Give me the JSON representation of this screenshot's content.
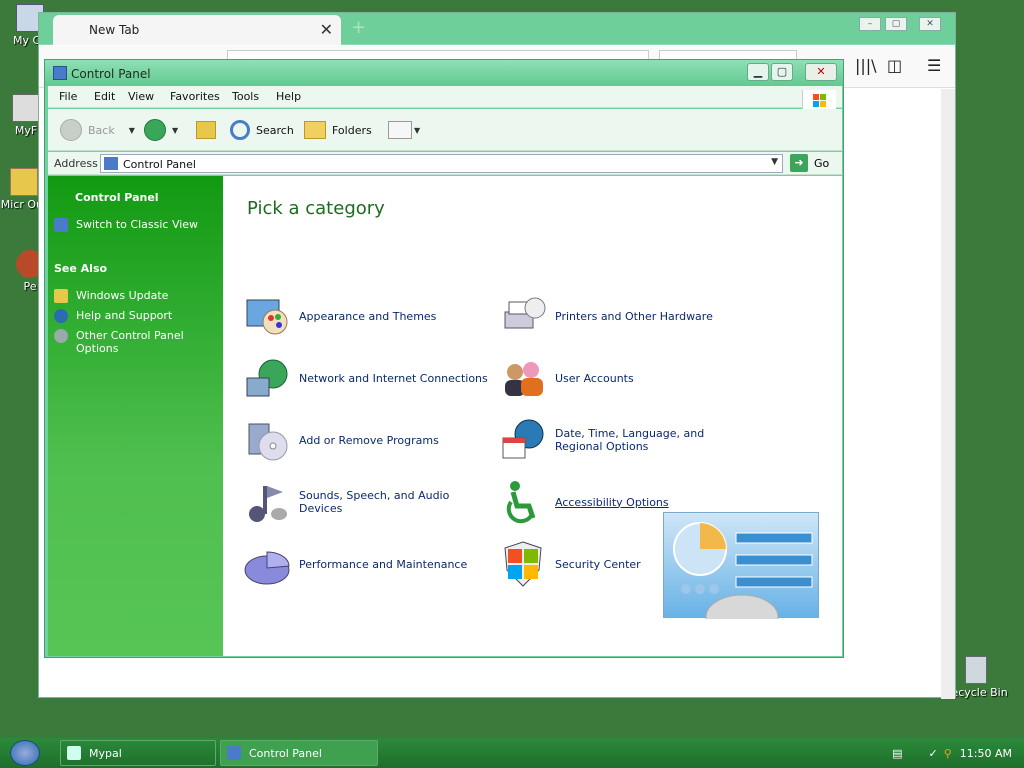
{
  "desktop": {
    "icons": [
      {
        "label": "My Co"
      },
      {
        "label": "MyF"
      },
      {
        "label": "Micr Out"
      },
      {
        "label": "Pe"
      }
    ],
    "recycle_bin": "Recycle Bin"
  },
  "browser": {
    "tab_title": "New Tab",
    "tab_close": "✕",
    "new_tab": "+"
  },
  "window": {
    "title": "Control Panel",
    "buttons": {
      "minimize": "▁",
      "maximize": "▢",
      "close": "✕"
    }
  },
  "menu": [
    "File",
    "Edit",
    "View",
    "Favorites",
    "Tools",
    "Help"
  ],
  "toolbar": {
    "back": "Back",
    "search": "Search",
    "folders": "Folders"
  },
  "address": {
    "label": "Address",
    "value": "Control Panel",
    "go": "Go"
  },
  "left_pane": {
    "section1_title": "Control Panel",
    "switch_view": "Switch to Classic View",
    "see_also_title": "See Also",
    "see_also": [
      "Windows Update",
      "Help and Support",
      "Other Control Panel Options"
    ]
  },
  "content": {
    "heading": "Pick a category",
    "categories": [
      "Appearance and Themes",
      "Printers and Other Hardware",
      "Network and Internet Connections",
      "User Accounts",
      "Add or Remove Programs",
      "Date, Time, Language, and Regional Options",
      "Sounds, Speech, and Audio Devices",
      "Accessibility Options",
      "Performance and Maintenance",
      "Security Center"
    ]
  },
  "taskbar": {
    "tasks": [
      "Mypal",
      "Control Panel"
    ],
    "clock": "11:50 AM"
  }
}
